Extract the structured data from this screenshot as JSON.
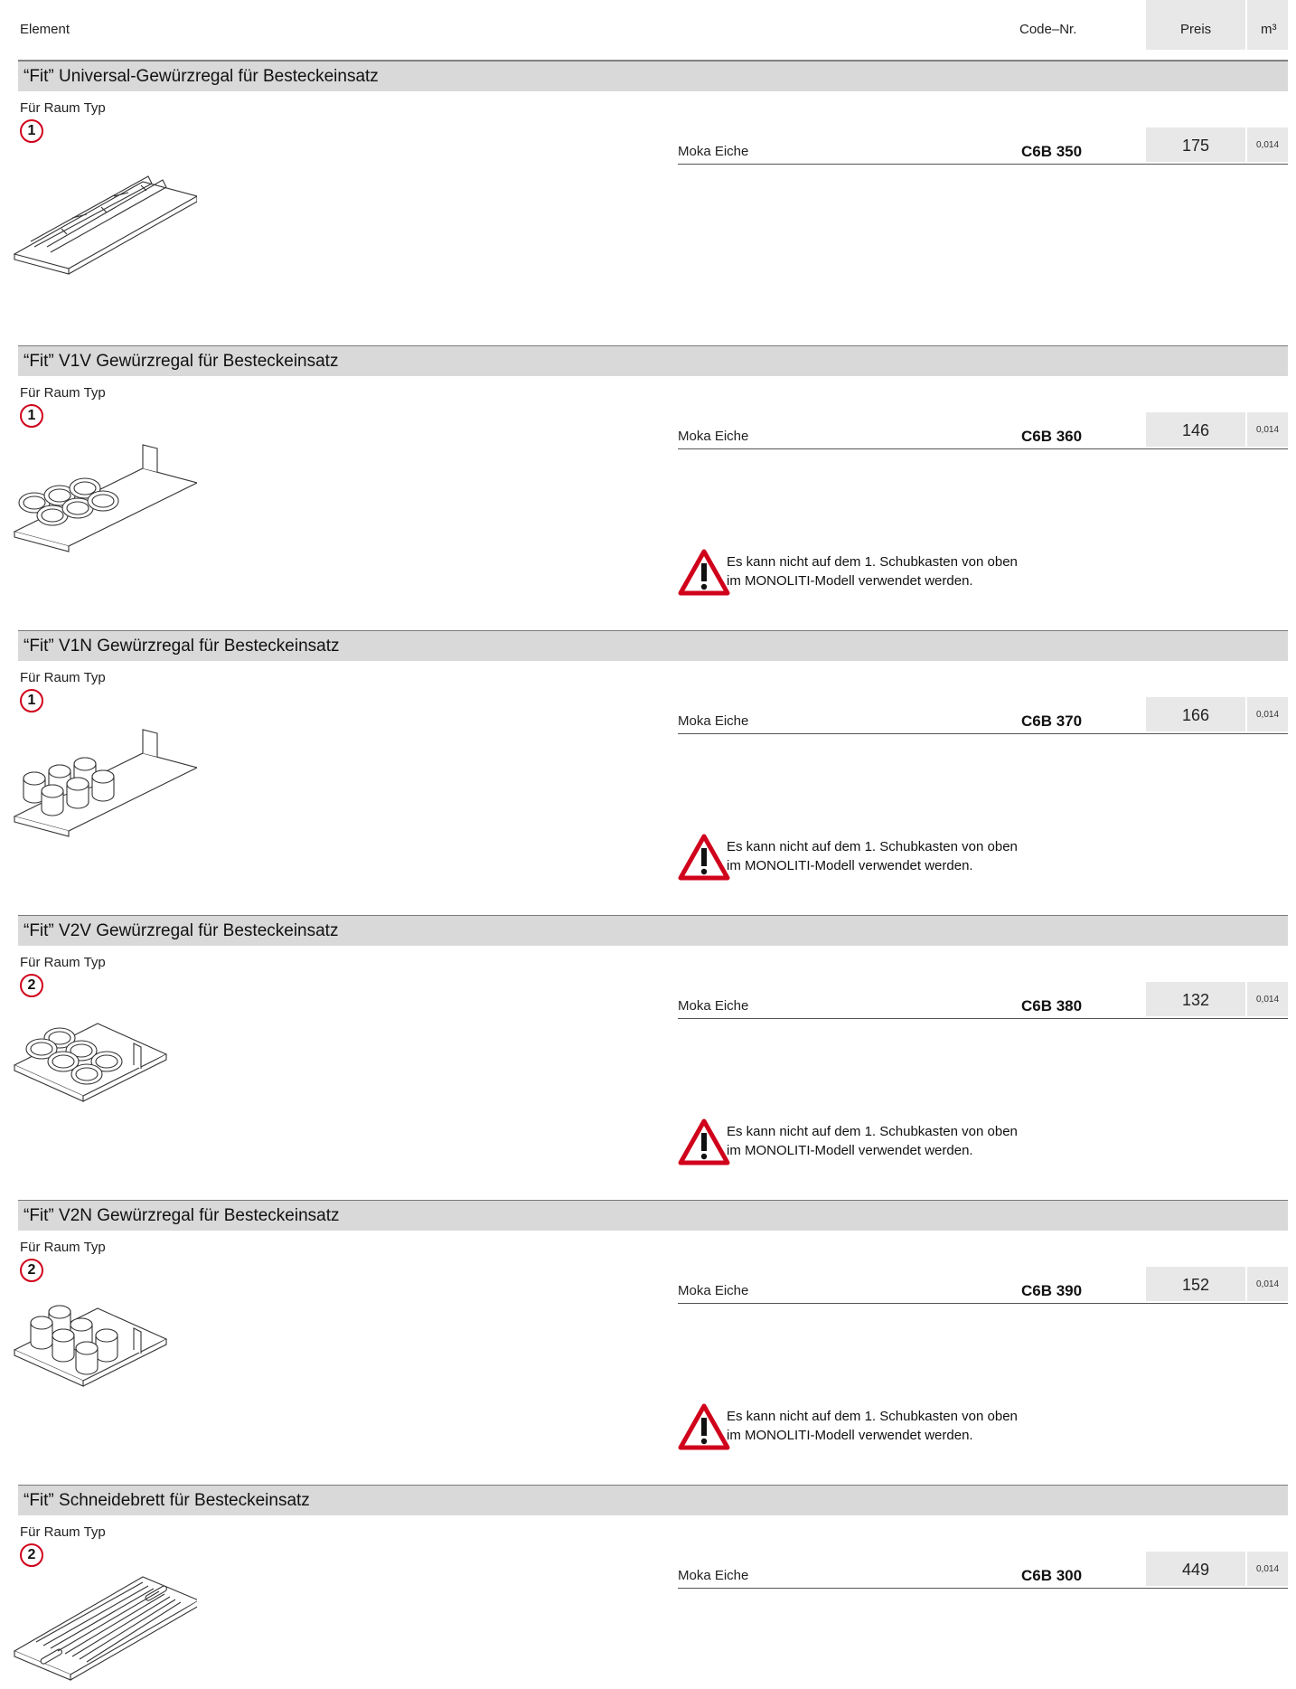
{
  "header": {
    "element": "Element",
    "code": "Code–Nr.",
    "preis": "Preis",
    "m3": "m³"
  },
  "sections": [
    {
      "title": "“Fit” Universal-Gewürzregal für Besteckeinsatz",
      "raum_label": "Für Raum Typ",
      "typ": "1",
      "material": "Moka Eiche",
      "code": "C6B 350",
      "price": "175",
      "volume": "0,014",
      "warning": ""
    },
    {
      "title": "“Fit” V1V Gewürzregal für Besteckeinsatz",
      "raum_label": "Für Raum Typ",
      "typ": "1",
      "material": "Moka Eiche",
      "code": "C6B 360",
      "price": "146",
      "volume": "0,014",
      "warning_line1": "Es kann nicht auf dem 1. Schubkasten von oben",
      "warning_line2": "im MONOLITI-Modell verwendet werden."
    },
    {
      "title": "“Fit” V1N Gewürzregal für Besteckeinsatz",
      "raum_label": "Für Raum Typ",
      "typ": "1",
      "material": "Moka Eiche",
      "code": "C6B 370",
      "price": "166",
      "volume": "0,014",
      "warning_line1": "Es kann nicht auf dem 1. Schubkasten von oben",
      "warning_line2": "im MONOLITI-Modell verwendet werden."
    },
    {
      "title": "“Fit” V2V Gewürzregal für Besteckeinsatz",
      "raum_label": "Für Raum Typ",
      "typ": "2",
      "material": "Moka Eiche",
      "code": "C6B 380",
      "price": "132",
      "volume": "0,014",
      "warning_line1": "Es kann nicht auf dem 1. Schubkasten von oben",
      "warning_line2": "im MONOLITI-Modell verwendet werden."
    },
    {
      "title": "“Fit” V2N Gewürzregal für Besteckeinsatz",
      "raum_label": "Für Raum Typ",
      "typ": "2",
      "material": "Moka Eiche",
      "code": "C6B 390",
      "price": "152",
      "volume": "0,014",
      "warning_line1": "Es kann nicht auf dem 1. Schubkasten von oben",
      "warning_line2": "im MONOLITI-Modell verwendet werden."
    },
    {
      "title": "“Fit” Schneidebrett für Besteckeinsatz",
      "raum_label": "Für Raum Typ",
      "typ": "2",
      "material": "Moka Eiche",
      "code": "C6B 300",
      "price": "449",
      "volume": "0,014"
    }
  ]
}
